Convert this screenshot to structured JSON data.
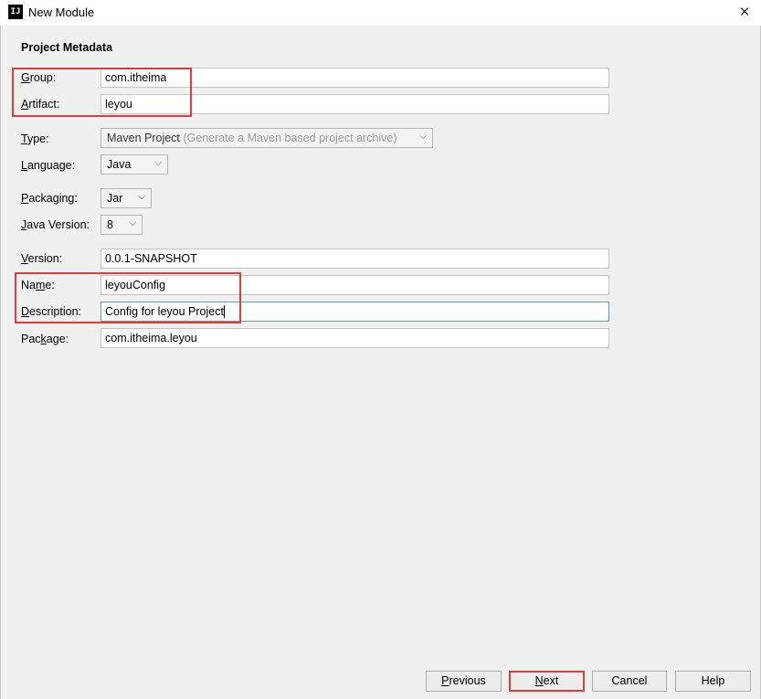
{
  "window": {
    "title": "New Module",
    "app_icon_text": "IJ",
    "close_glyph": "✕"
  },
  "section": {
    "title": "Project Metadata"
  },
  "fields": {
    "group": {
      "mnemonic": "G",
      "label_rest": "roup:",
      "value": "com.itheima"
    },
    "artifact": {
      "mnemonic": "A",
      "label_rest": "rtifact:",
      "value": "leyou"
    },
    "type": {
      "mnemonic": "T",
      "label_rest": "ype:",
      "value": "Maven Project",
      "hint": "(Generate a Maven based project archive)"
    },
    "language": {
      "mnemonic": "L",
      "label_rest": "anguage:",
      "value": "Java"
    },
    "packaging": {
      "mnemonic": "P",
      "label_rest": "ackaging:",
      "value": "Jar"
    },
    "java_version": {
      "mnemonic": "J",
      "label_rest": "ava Version:",
      "value": "8"
    },
    "version": {
      "mnemonic": "V",
      "label_rest": "ersion:",
      "value": "0.0.1-SNAPSHOT"
    },
    "name": {
      "label_pre": "Na",
      "mnemonic": "m",
      "label_rest": "e:",
      "value": "leyouConfig"
    },
    "description": {
      "mnemonic": "D",
      "label_rest": "escription:",
      "value": "Config for leyou Project"
    },
    "package": {
      "label_pre": "Pac",
      "mnemonic": "k",
      "label_rest": "age:",
      "value": "com.itheima.leyou"
    }
  },
  "buttons": {
    "previous": {
      "mnemonic": "P",
      "rest": "revious"
    },
    "next": {
      "mnemonic": "N",
      "rest": "ext"
    },
    "cancel": {
      "label": "Cancel"
    },
    "help": {
      "label": "Help"
    }
  },
  "icons": {
    "dropdown_arrow": "⌵"
  },
  "colors": {
    "highlight_box": "#e03c3c",
    "focus_border": "#5b9bd5",
    "hint_text": "#9a9a9a"
  }
}
